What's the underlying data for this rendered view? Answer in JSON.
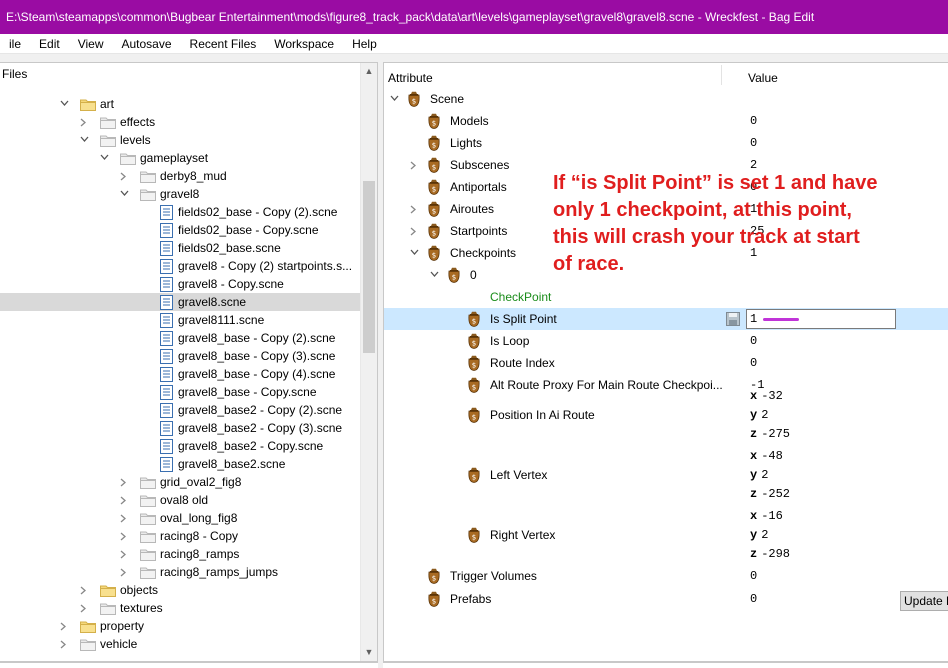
{
  "window": {
    "title": "E:\\Steam\\steamapps\\common\\Bugbear Entertainment\\mods\\figure8_track_pack\\data\\art\\levels\\gameplayset\\gravel8\\gravel8.scne - Wreckfest - Bag Edit",
    "accent_color": "#9a0ca3"
  },
  "menu": [
    "ile",
    "Edit",
    "View",
    "Autosave",
    "Recent Files",
    "Workspace",
    "Help"
  ],
  "files_panel": {
    "header": "Files",
    "rows": [
      {
        "label": "art",
        "type": "folder",
        "level": 3,
        "expanded": true
      },
      {
        "label": "effects",
        "type": "folder",
        "level": 4,
        "expanded": false
      },
      {
        "label": "levels",
        "type": "folder",
        "level": 4,
        "expanded": true
      },
      {
        "label": "gameplayset",
        "type": "folder",
        "level": 5,
        "expanded": true
      },
      {
        "label": "derby8_mud",
        "type": "folder",
        "level": 6,
        "expanded": false
      },
      {
        "label": "gravel8",
        "type": "folder",
        "level": 6,
        "expanded": true
      },
      {
        "label": "fields02_base - Copy (2).scne",
        "type": "file",
        "level": 7
      },
      {
        "label": "fields02_base - Copy.scne",
        "type": "file",
        "level": 7
      },
      {
        "label": "fields02_base.scne",
        "type": "file",
        "level": 7
      },
      {
        "label": "gravel8 - Copy (2)  startpoints.s...",
        "type": "file",
        "level": 7
      },
      {
        "label": "gravel8 - Copy.scne",
        "type": "file",
        "level": 7
      },
      {
        "label": "gravel8.scne",
        "type": "file",
        "level": 7,
        "selected": true
      },
      {
        "label": "gravel8111.scne",
        "type": "file",
        "level": 7
      },
      {
        "label": "gravel8_base - Copy (2).scne",
        "type": "file",
        "level": 7
      },
      {
        "label": "gravel8_base - Copy (3).scne",
        "type": "file",
        "level": 7
      },
      {
        "label": "gravel8_base - Copy (4).scne",
        "type": "file",
        "level": 7
      },
      {
        "label": "gravel8_base - Copy.scne",
        "type": "file",
        "level": 7
      },
      {
        "label": "gravel8_base2 - Copy (2).scne",
        "type": "file",
        "level": 7
      },
      {
        "label": "gravel8_base2 - Copy (3).scne",
        "type": "file",
        "level": 7
      },
      {
        "label": "gravel8_base2 - Copy.scne",
        "type": "file",
        "level": 7
      },
      {
        "label": "gravel8_base2.scne",
        "type": "file",
        "level": 7
      },
      {
        "label": "grid_oval2_fig8",
        "type": "folder",
        "level": 6,
        "expanded": false
      },
      {
        "label": "oval8 old",
        "type": "folder",
        "level": 6,
        "expanded": false
      },
      {
        "label": "oval_long_fig8",
        "type": "folder",
        "level": 6,
        "expanded": false
      },
      {
        "label": "racing8 - Copy",
        "type": "folder",
        "level": 6,
        "expanded": false
      },
      {
        "label": "racing8_ramps",
        "type": "folder",
        "level": 6,
        "expanded": false
      },
      {
        "label": "racing8_ramps_jumps",
        "type": "folder",
        "level": 6,
        "expanded": false
      },
      {
        "label": "objects",
        "type": "folder",
        "level": 4,
        "expanded": false
      },
      {
        "label": "textures",
        "type": "folder",
        "level": 4,
        "expanded": false
      },
      {
        "label": "property",
        "type": "folder",
        "level": 3,
        "expanded": false
      },
      {
        "label": "vehicle",
        "type": "folder",
        "level": 3,
        "expanded": false
      }
    ]
  },
  "properties_panel": {
    "col_attribute": "Attribute",
    "col_value": "Value",
    "rows": [
      {
        "name": "Scene",
        "value": "",
        "level": 0,
        "chevron": "down"
      },
      {
        "name": "Models",
        "value": "0",
        "level": 1,
        "chevron": ""
      },
      {
        "name": "Lights",
        "value": "0",
        "level": 1,
        "chevron": ""
      },
      {
        "name": "Subscenes",
        "value": "2",
        "level": 1,
        "chevron": "right"
      },
      {
        "name": "Antiportals",
        "value": "0",
        "level": 1,
        "chevron": ""
      },
      {
        "name": "Airoutes",
        "value": "1",
        "level": 1,
        "chevron": "right"
      },
      {
        "name": "Startpoints",
        "value": "25",
        "level": 1,
        "chevron": "right"
      },
      {
        "name": "Checkpoints",
        "value": "1",
        "level": 1,
        "chevron": "down"
      },
      {
        "name": "0",
        "value": "",
        "level": 2,
        "chevron": "down"
      },
      {
        "name": "CheckPoint",
        "value": "",
        "level": 3,
        "chevron": "",
        "green": true,
        "noicon": true
      },
      {
        "name": "Is Split Point",
        "value": "1",
        "level": 3,
        "chevron": "",
        "selected": true,
        "editing": true
      },
      {
        "name": "Is Loop",
        "value": "0",
        "level": 3,
        "chevron": ""
      },
      {
        "name": "Route Index",
        "value": "0",
        "level": 3,
        "chevron": ""
      },
      {
        "name": "Alt Route Proxy For Main Route Checkpoi...",
        "value": "-1",
        "level": 3,
        "chevron": ""
      }
    ],
    "vectors": [
      {
        "name": "Position In Ai Route",
        "x": "-32",
        "y": "2",
        "z": "-275"
      },
      {
        "name": "Left Vertex",
        "x": "-48",
        "y": "2",
        "z": "-252"
      },
      {
        "name": "Right Vertex",
        "x": "-16",
        "y": "2",
        "z": "-298"
      }
    ],
    "tail_rows": [
      {
        "name": "Trigger Volumes",
        "value": "0"
      },
      {
        "name": "Prefabs",
        "value": "0"
      }
    ],
    "update_button": "Update R"
  },
  "annotation": {
    "text": "If “is Split Point” is set 1 and have only 1 checkpoint, at this point, this will crash your track at start of race.",
    "color": "#e01e1e"
  }
}
